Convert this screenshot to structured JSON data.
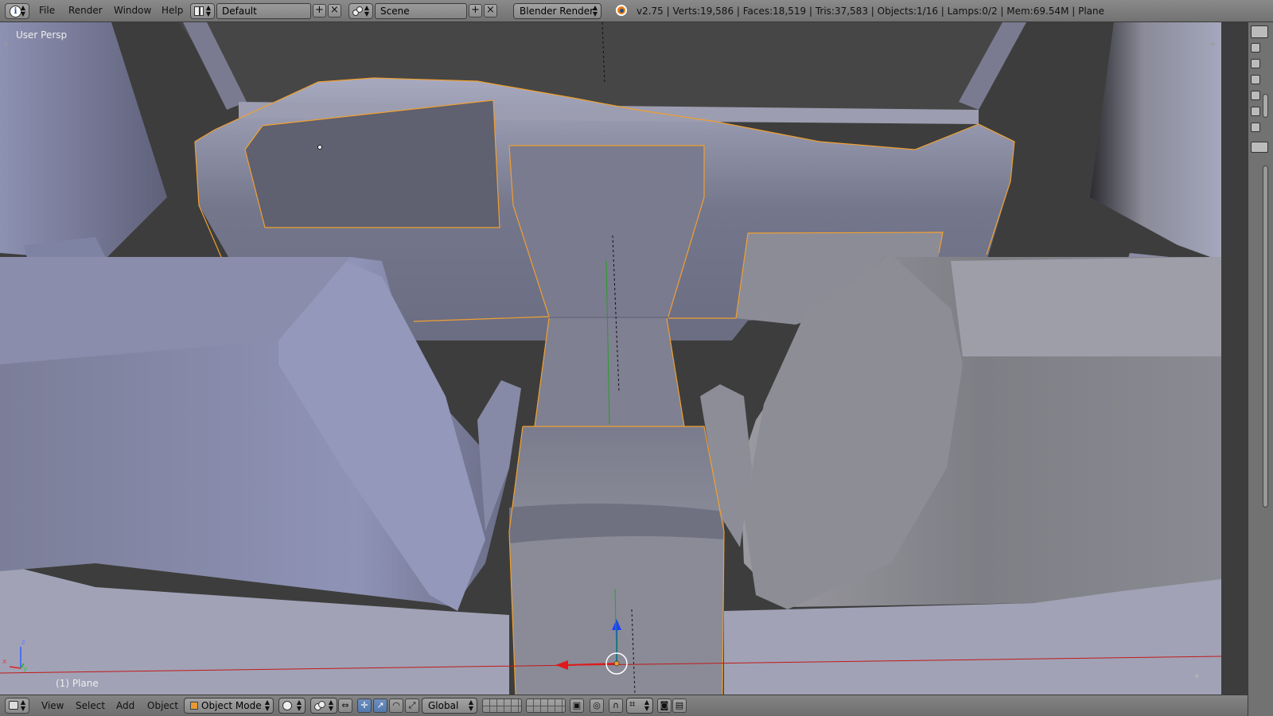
{
  "topbar": {
    "editor_icon": "info-icon",
    "menus": [
      "File",
      "Render",
      "Window",
      "Help"
    ],
    "layout_icon": "screen-layout-icon",
    "screen_layout": "Default",
    "scene_icon": "scene-icon",
    "scene": "Scene",
    "render_engine": "Blender Render",
    "blender_logo": "blender-logo-icon",
    "stats": "v2.75 | Verts:19,586 | Faces:18,519 | Tris:37,583 | Objects:1/16 | Lamps:0/2 | Mem:69.54M | Plane"
  },
  "viewport": {
    "view_label": "User Persp",
    "object_label": "(1) Plane",
    "selection_color": "#f0a030",
    "background_color": "#3d3d3d"
  },
  "bottombar": {
    "editor_icon": "3d-view-icon",
    "menus": [
      "View",
      "Select",
      "Add",
      "Object"
    ],
    "mode": "Object Mode",
    "shading_icon": "solid-shading-icon",
    "pivot_icon": "pivot-point-icon",
    "transform_orientation": "Global"
  }
}
